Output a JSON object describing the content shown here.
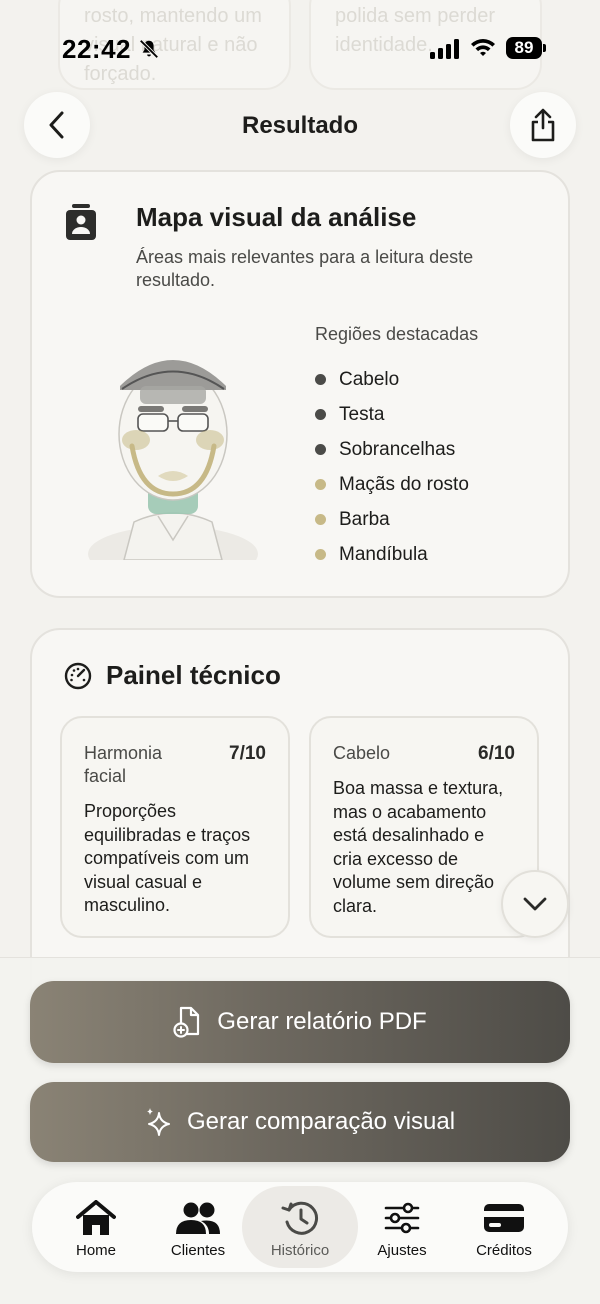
{
  "status_bar": {
    "time": "22:42",
    "battery": "89"
  },
  "background_cards": [
    {
      "text": "rosto, mantendo um visual natural e não forçado."
    },
    {
      "text": "polida sem perder identidade."
    }
  ],
  "header": {
    "title": "Resultado"
  },
  "visual_map": {
    "title": "Mapa visual da análise",
    "subtitle": "Áreas mais relevantes para a leitura deste resultado.",
    "regions_title": "Regiões destacadas",
    "regions": [
      {
        "label": "Cabelo",
        "color": "#4b4b48"
      },
      {
        "label": "Testa",
        "color": "#4b4b48"
      },
      {
        "label": "Sobrancelhas",
        "color": "#4b4b48"
      },
      {
        "label": "Maçãs do rosto",
        "color": "#c7b987"
      },
      {
        "label": "Barba",
        "color": "#c7b987"
      },
      {
        "label": "Mandíbula",
        "color": "#c7b987"
      }
    ]
  },
  "tech_panel": {
    "title": "Painel técnico",
    "metrics": [
      {
        "name": "Harmonia facial",
        "score": "7/10",
        "text": "Proporções equilibradas e traços compatíveis com um visual casual e masculino."
      },
      {
        "name": "Cabelo",
        "score": "6/10",
        "text": "Boa massa e textura, mas o acabamento está desalinhado e cria excesso de volume sem direção clara."
      }
    ]
  },
  "actions": {
    "pdf_label": "Gerar relatório PDF",
    "compare_label": "Gerar comparação visual"
  },
  "tabs": [
    {
      "label": "Home",
      "icon": "home-icon"
    },
    {
      "label": "Clientes",
      "icon": "clients-icon"
    },
    {
      "label": "Histórico",
      "icon": "history-icon",
      "active": true
    },
    {
      "label": "Ajustes",
      "icon": "sliders-icon"
    },
    {
      "label": "Créditos",
      "icon": "card-icon"
    }
  ],
  "colors": {
    "accent_dark": "#4b4b48",
    "accent_gold": "#c7b987",
    "beard_green": "#9cc6b2"
  }
}
